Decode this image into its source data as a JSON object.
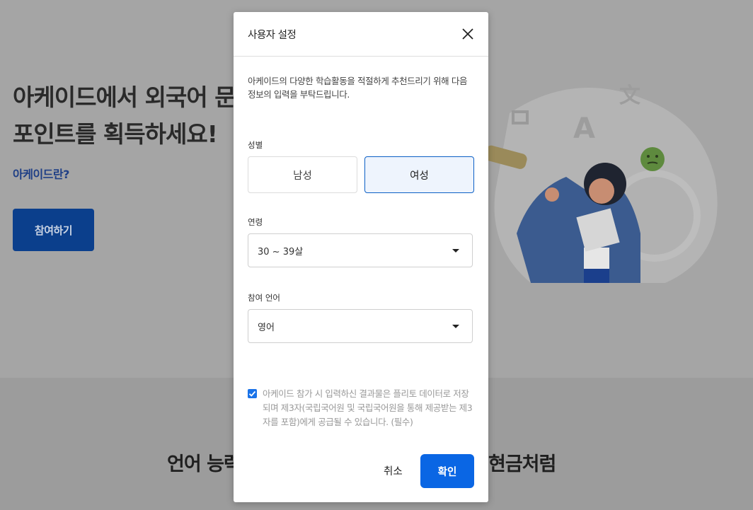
{
  "background": {
    "hero_title_line1": "아케이드에서 외국어 문",
    "hero_title_line2": "포인트를 획득하세요!",
    "hero_link": "아케이드란?",
    "hero_button": "참여하기",
    "bottom_text_left": "언어 능력",
    "bottom_text_right": "현금처럼"
  },
  "modal": {
    "title": "사용자 설정",
    "intro": "아케이드의 다양한 학습활동을 적절하게 추천드리기 위해 다음 정보의 입력을 부탁드립니다.",
    "gender": {
      "label": "성별",
      "options": [
        "남성",
        "여성"
      ],
      "selected": "여성"
    },
    "age": {
      "label": "연령",
      "value": "30 ~ 39살"
    },
    "language": {
      "label": "참여 언어",
      "value": "영어"
    },
    "consent": {
      "checked": true,
      "text": "아케이드 참가 시 입력하신 결과물은 플리토 데이터로 저장되며 제3자(국립국어원 및 국립국어원을 통해 제공받는 제3자를 포함)에게 공급될 수 있습니다. (필수)"
    },
    "cancel_label": "취소",
    "confirm_label": "확인"
  },
  "colors": {
    "accent": "#0a66e4",
    "selected_border": "#0c60c6",
    "overlay": "#a3a3a3"
  },
  "icons": {
    "close": "close-icon",
    "dropdown": "caret-down-icon",
    "check": "check-icon"
  }
}
